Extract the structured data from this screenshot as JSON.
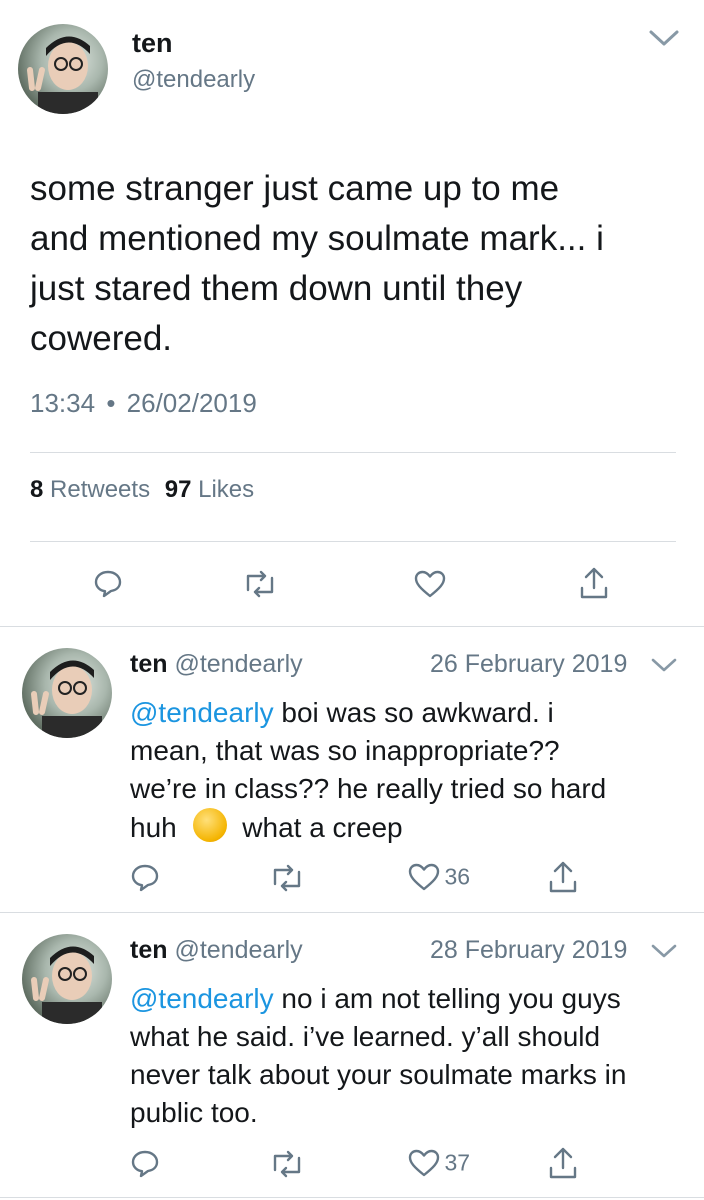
{
  "colors": {
    "accent": "#1b95e0",
    "muted": "#657786",
    "text": "#14171a",
    "divider": "#d9dde1"
  },
  "main_tweet": {
    "display_name": "ten",
    "handle": "@tendearly",
    "text_lines": [
      "some stranger just came up to me",
      "and mentioned my soulmate mark... i",
      "just stared them down until they",
      "cowered."
    ],
    "time": "13:34",
    "separator": "•",
    "date": "26/02/2019",
    "retweets_count": "8",
    "retweets_label": "Retweets",
    "likes_count": "97",
    "likes_label": "Likes",
    "actions": [
      "reply-icon",
      "retweet-icon",
      "like-icon",
      "share-icon"
    ]
  },
  "replies": [
    {
      "display_name": "ten",
      "handle": "@tendearly",
      "date": "26 February 2019",
      "mention": "@tendearly",
      "lines": [
        " boi was so awkward. i",
        "mean,  that was so inappropriate??",
        "we’re in class?? he really tried so hard",
        "huh",
        " what a creep"
      ],
      "emoji": "😩",
      "like_count": "36"
    },
    {
      "display_name": "ten",
      "handle": "@tendearly",
      "date": "28 February 2019",
      "mention": "@tendearly",
      "lines": [
        " no i am not telling you guys",
        "what he said. i’ve learned. y’all should",
        "never talk about your soulmate marks in",
        "public too."
      ],
      "like_count": "37"
    }
  ]
}
